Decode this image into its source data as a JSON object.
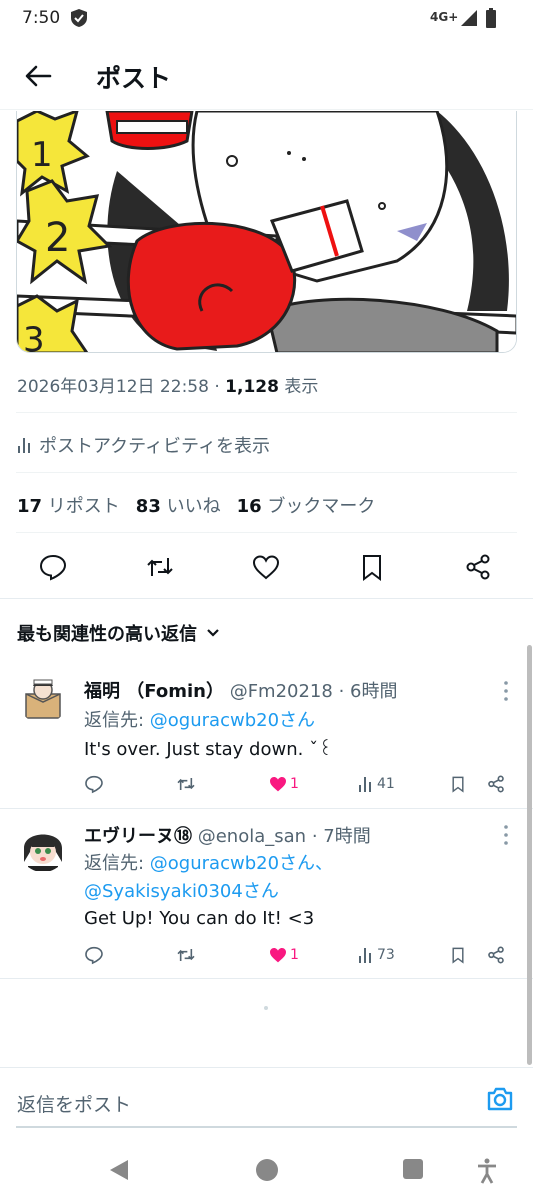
{
  "status": {
    "time": "7:50",
    "network": "4G+"
  },
  "header": {
    "title": "ポスト"
  },
  "post": {
    "date": "2026年03月12日 22:58",
    "separator": "·",
    "views": "1,128",
    "views_label": "表示",
    "activity_label": "ポストアクティビティを表示",
    "reposts_count": "17",
    "reposts_label": "リポスト",
    "likes_count": "83",
    "likes_label": "いいね",
    "bookmarks_count": "16",
    "bookmarks_label": "ブックマーク"
  },
  "sort": {
    "label": "最も関連性の高い返信"
  },
  "replies": [
    {
      "name": "福明 （Fomin）",
      "handle": "@Fm20218",
      "time": "6時間",
      "reply_prefix": "返信先: ",
      "mention1": "@oguracwb20さん",
      "text": "It's over. Just stay down. ˇ꒰",
      "likes": "1",
      "views": "41"
    },
    {
      "name": "エヴリーヌ⑱",
      "handle": "@enola_san",
      "time": "7時間",
      "reply_prefix": "返信先: ",
      "mention1": "@oguracwb20さん、",
      "mention2": "@Syakisyaki0304さん",
      "text": "Get Up! You can do It! <3",
      "likes": "1",
      "views": "73"
    }
  ],
  "composer": {
    "placeholder": "返信をポスト"
  },
  "colors": {
    "accent": "#1d9bf0",
    "like": "#f91880",
    "secondary": "#536471"
  }
}
